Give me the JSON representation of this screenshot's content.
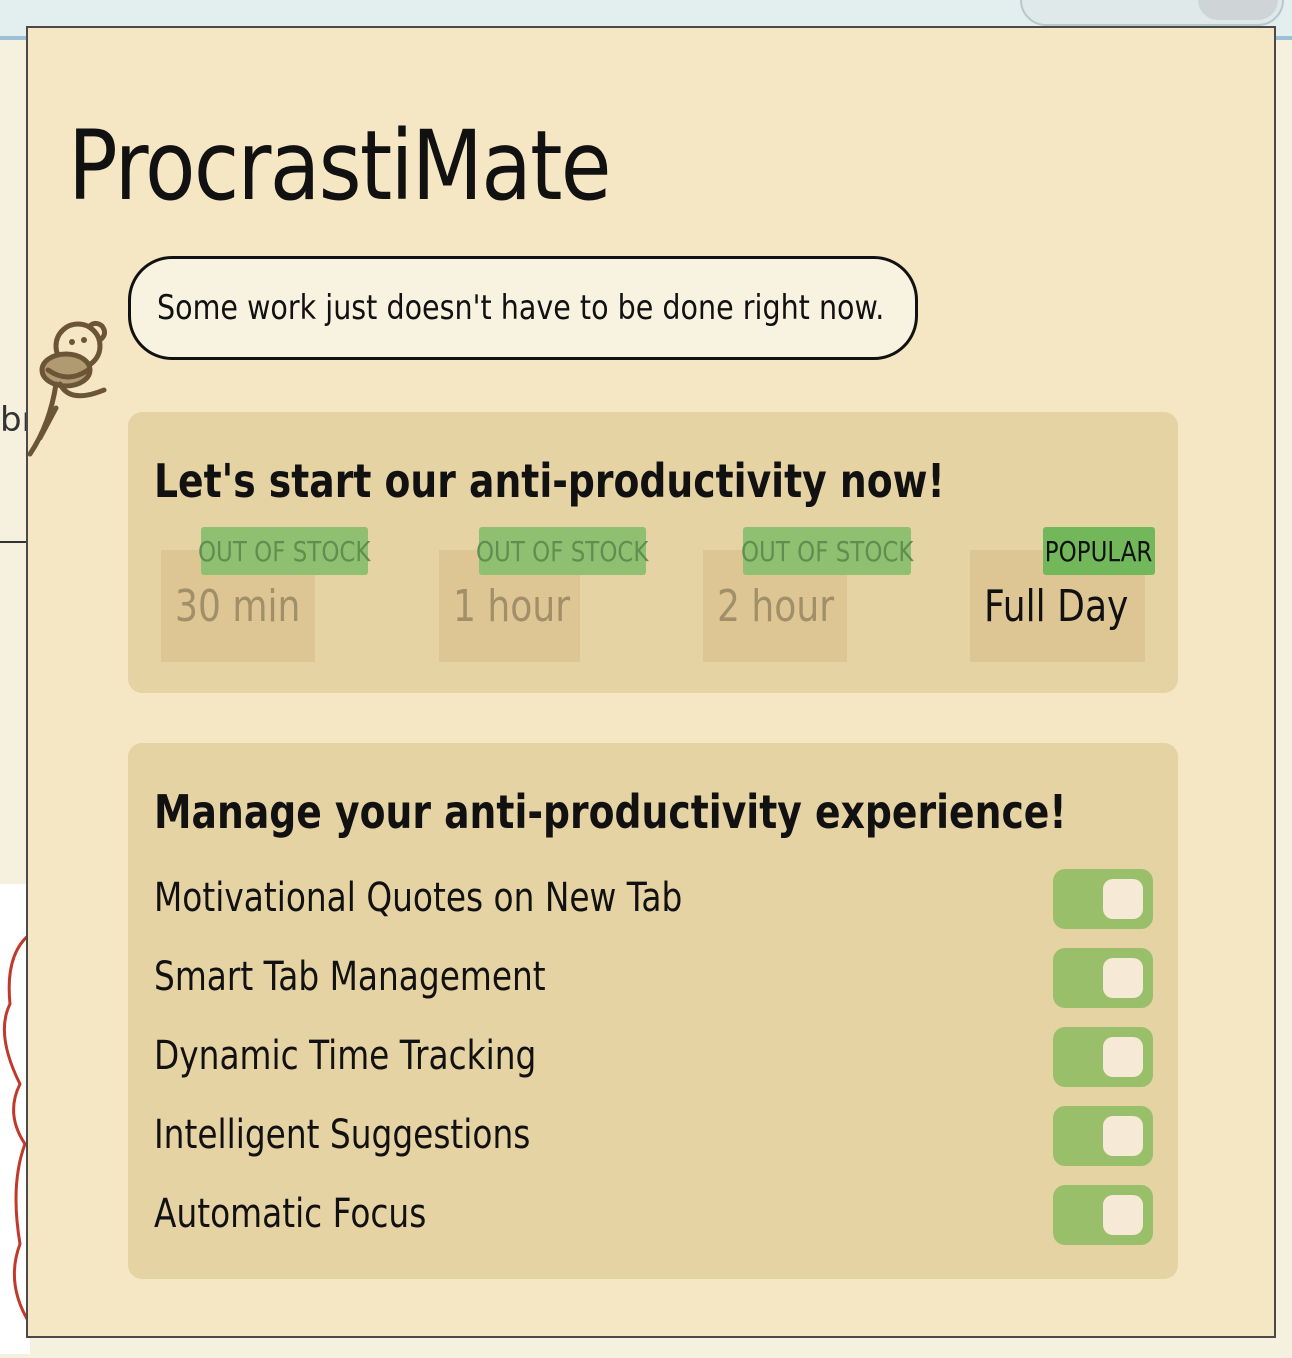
{
  "app": {
    "title": "ProcrastiMate"
  },
  "speech": {
    "text": "Some work just doesn't have to be done right now."
  },
  "background": {
    "fragment_text": "br"
  },
  "timer": {
    "heading": "Let's start our anti-productivity now!",
    "options": [
      {
        "label": "30 min",
        "badge": "OUT OF STOCK",
        "status": "disabled"
      },
      {
        "label": "1 hour",
        "badge": "OUT OF STOCK",
        "status": "disabled"
      },
      {
        "label": "2 hour",
        "badge": "OUT OF STOCK",
        "status": "disabled"
      },
      {
        "label": "Full Day",
        "badge": "POPULAR",
        "status": "active"
      }
    ]
  },
  "settings": {
    "heading": "Manage your anti-productivity experience!",
    "items": [
      {
        "label": "Motivational Quotes on New Tab",
        "enabled": true
      },
      {
        "label": "Smart Tab Management",
        "enabled": true
      },
      {
        "label": "Dynamic Time Tracking",
        "enabled": true
      },
      {
        "label": "Intelligent Suggestions",
        "enabled": true
      },
      {
        "label": "Automatic Focus",
        "enabled": true
      }
    ]
  },
  "colors": {
    "popup_bg": "#f6e7c4",
    "card_bg": "#e6d3a4",
    "toggle_on": "#9abf6b",
    "badge_popular": "#72b85b",
    "badge_out_of_stock": "#8fc071"
  },
  "icons": {
    "mascot": "monkey-mascot-icon"
  }
}
